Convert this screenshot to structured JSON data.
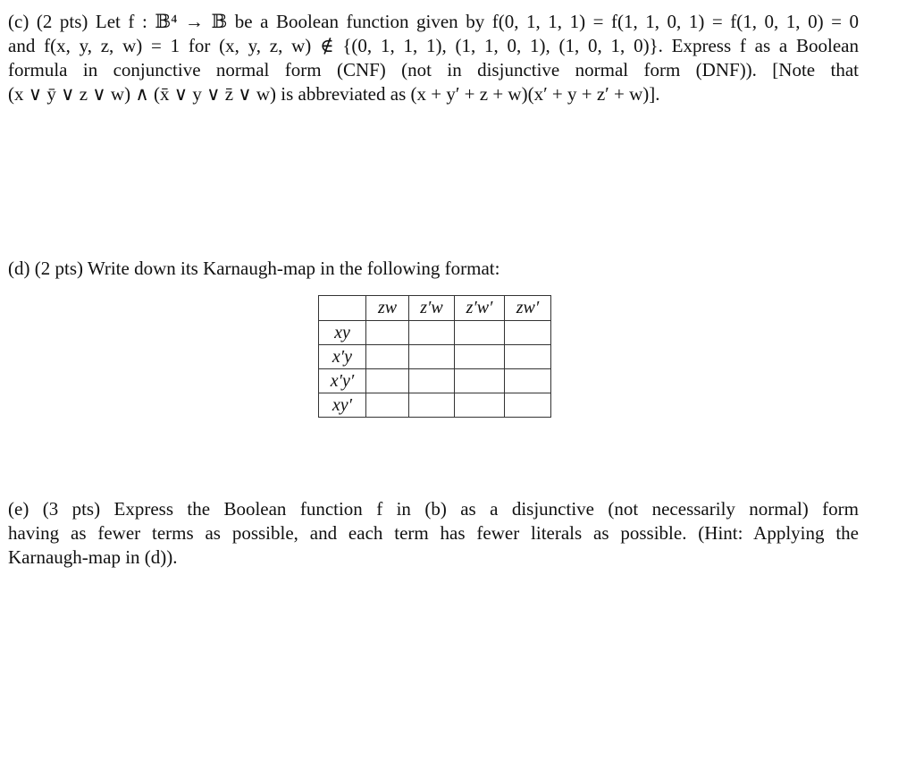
{
  "part_c": {
    "lines": [
      "(c) (2 pts) Let f : 𝔹⁴ → 𝔹 be a Boolean function given by f(0, 1, 1, 1) = f(1, 1, 0, 1) = f(1, 0, 1, 0) = 0",
      "and  f(x, y, z, w)  =  1  for  (x, y, z, w)  ∉  {(0, 1, 1, 1), (1, 1, 0, 1), (1, 0, 1, 0)}.  Express  f  as a Boolean",
      "formula  in  conjunctive  normal  form  (CNF)  (not  in  disjunctive  normal  form  (DNF)).  [Note  that",
      "(x ∨ ȳ ∨ z ∨ w) ∧ (x̄ ∨ y ∨ z̄ ∨ w) is abbreviated as (x + y′ + z + w)(x′ + y + z′ + w)]."
    ]
  },
  "part_d": {
    "text": "(d) (2 pts) Write down its Karnaugh-map in the following format:"
  },
  "kmap": {
    "corner": "",
    "col_headers": [
      "zw",
      "z′w",
      "z′w′",
      "zw′"
    ],
    "rows": [
      {
        "label": "xy",
        "cells": [
          "",
          "",
          "",
          ""
        ]
      },
      {
        "label": "x′y",
        "cells": [
          "",
          "",
          "",
          ""
        ]
      },
      {
        "label": "x′y′",
        "cells": [
          "",
          "",
          "",
          ""
        ]
      },
      {
        "label": "xy′",
        "cells": [
          "",
          "",
          "",
          ""
        ]
      }
    ]
  },
  "part_e": {
    "lines": [
      "(e) (3 pts) Express the Boolean function f in (b) as a disjunctive (not necessarily normal) form",
      "having as fewer terms as possible, and each term has fewer literals as possible. (Hint: Applying the",
      "Karnaugh-map in (d))."
    ]
  }
}
